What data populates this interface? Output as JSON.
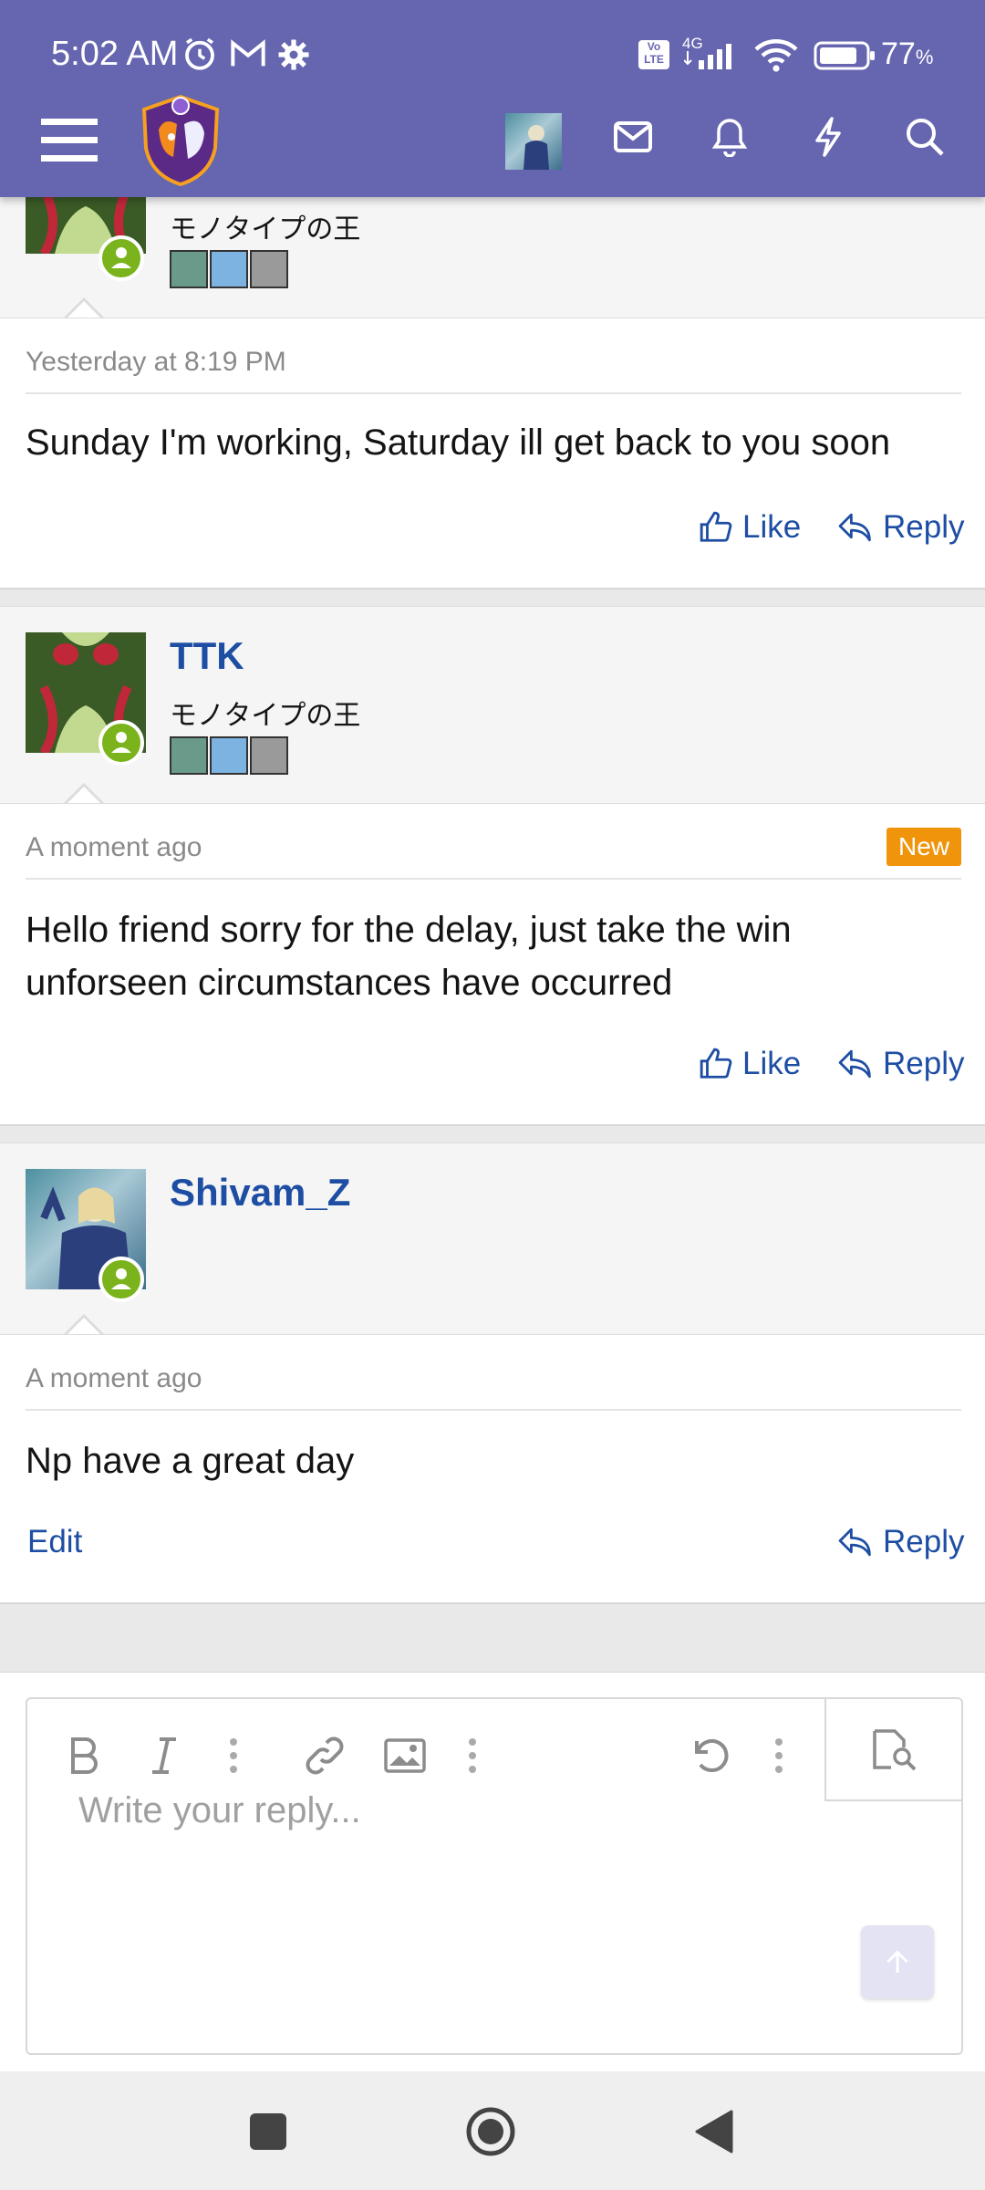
{
  "status_bar": {
    "time": "5:02 AM",
    "battery_percent": "77",
    "battery_unit": "%",
    "network": "4G",
    "volte": "Vo LTE"
  },
  "header": {
    "menu_icon": "hamburger-menu-icon",
    "logo": "site-logo",
    "icons": [
      "avatar",
      "mail-icon",
      "bell-icon",
      "lightning-icon",
      "search-icon"
    ]
  },
  "posts": [
    {
      "username": "",
      "user_title": "モノタイプの王",
      "timestamp": "Yesterday at 8:19 PM",
      "message": "Sunday I'm working, Saturday ill get back to you soon",
      "actions": {
        "like": "Like",
        "reply": "Reply"
      }
    },
    {
      "username": "TTK",
      "user_title": "モノタイプの王",
      "timestamp": "A moment ago",
      "badge": "New",
      "message": "Hello friend sorry for the delay, just take the win unforseen circumstances have occurred",
      "actions": {
        "like": "Like",
        "reply": "Reply"
      }
    },
    {
      "username": "Shivam_Z",
      "timestamp": "A moment ago",
      "message": "Np have a great day",
      "actions": {
        "edit": "Edit",
        "reply": "Reply"
      }
    }
  ],
  "editor": {
    "placeholder": "Write your reply...",
    "toolbar": [
      "bold-icon",
      "italic-icon",
      "more-options-icon",
      "link-icon",
      "image-icon",
      "more-options-icon",
      "undo-icon",
      "more-options-icon",
      "preview-icon"
    ]
  },
  "colors": {
    "header": "#6665b0",
    "link": "#1d4ea3",
    "online": "#7ab31c",
    "new_badge": "#f0940c"
  }
}
